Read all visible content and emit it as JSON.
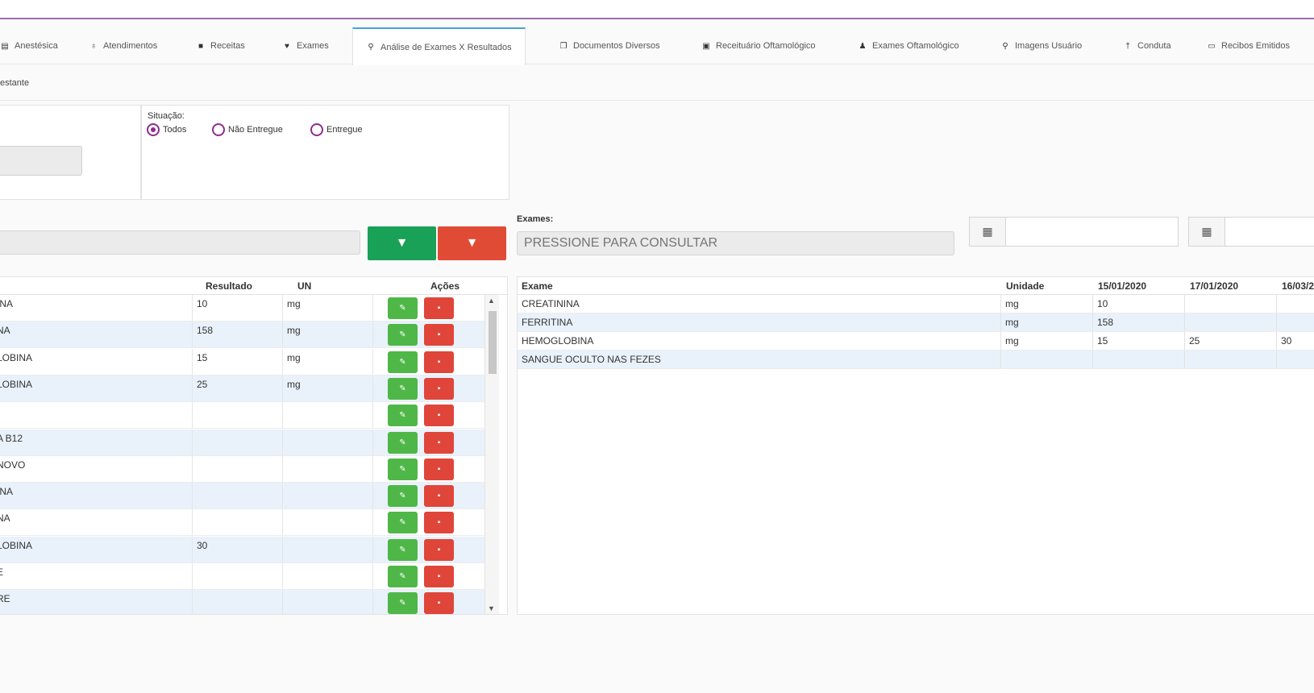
{
  "tabs": [
    {
      "label": "Anestésica",
      "icon": "clipboard-icon"
    },
    {
      "label": "Atendimentos",
      "icon": "stethoscope-icon"
    },
    {
      "label": "Receitas",
      "icon": "file-icon"
    },
    {
      "label": "Exames",
      "icon": "heartbeat-icon"
    },
    {
      "label": "Análise de Exames X Resultados",
      "icon": "search-icon",
      "active": true
    },
    {
      "label": "Documentos Diversos",
      "icon": "copy-icon"
    },
    {
      "label": "Receituário Oftamológico",
      "icon": "book-icon"
    },
    {
      "label": "Exames Oftamológico",
      "icon": "user-md-icon"
    },
    {
      "label": "Imagens Usuário",
      "icon": "search-icon"
    },
    {
      "label": "Conduta",
      "icon": "pin-icon"
    },
    {
      "label": "Recibos Emitidos",
      "icon": "money-icon"
    }
  ],
  "subtab": {
    "label": "estante"
  },
  "situacao": {
    "label": "Situação:",
    "options": [
      {
        "label": "Todos",
        "checked": true
      },
      {
        "label": "Não Entregue",
        "checked": false
      },
      {
        "label": "Entregue",
        "checked": false
      }
    ]
  },
  "exames": {
    "label": "Exames:",
    "placeholder": "PRESSIONE PARA CONSULTAR"
  },
  "left_table": {
    "headers": {
      "resultado": "Resultado",
      "un": "UN",
      "acoes": "Ações"
    },
    "rows": [
      {
        "name": "INA",
        "resultado": "10",
        "un": "mg"
      },
      {
        "name": "NA",
        "resultado": "158",
        "un": "mg"
      },
      {
        "name": "LOBINA",
        "resultado": "15",
        "un": "mg"
      },
      {
        "name": "LOBINA",
        "resultado": "25",
        "un": "mg"
      },
      {
        "name": "",
        "resultado": "",
        "un": ""
      },
      {
        "name": "A B12",
        "resultado": "",
        "un": ""
      },
      {
        "name": "NOVO",
        "resultado": "",
        "un": ""
      },
      {
        "name": "INA",
        "resultado": "",
        "un": ""
      },
      {
        "name": "NA",
        "resultado": "",
        "un": ""
      },
      {
        "name": "LOBINA",
        "resultado": "30",
        "un": ""
      },
      {
        "name": "E",
        "resultado": "",
        "un": ""
      },
      {
        "name": "RE",
        "resultado": "",
        "un": ""
      }
    ]
  },
  "right_table": {
    "headers": {
      "exame": "Exame",
      "unidade": "Unidade",
      "d1": "15/01/2020",
      "d2": "17/01/2020",
      "d3": "16/03/2"
    },
    "rows": [
      {
        "exame": "CREATININA",
        "unidade": "mg",
        "d1": "10",
        "d2": "",
        "d3": ""
      },
      {
        "exame": "FERRITINA",
        "unidade": "mg",
        "d1": "158",
        "d2": "",
        "d3": ""
      },
      {
        "exame": "HEMOGLOBINA",
        "unidade": "mg",
        "d1": "15",
        "d2": "25",
        "d3": "30"
      },
      {
        "exame": "SANGUE OCULTO NAS FEZES",
        "unidade": "",
        "d1": "",
        "d2": "",
        "d3": ""
      }
    ]
  },
  "colors": {
    "accent_purple": "#8e2d91",
    "filter_green": "#18a157",
    "filter_red": "#e04b35",
    "edit_green": "#4fb748",
    "delete_red": "#e0453a"
  }
}
